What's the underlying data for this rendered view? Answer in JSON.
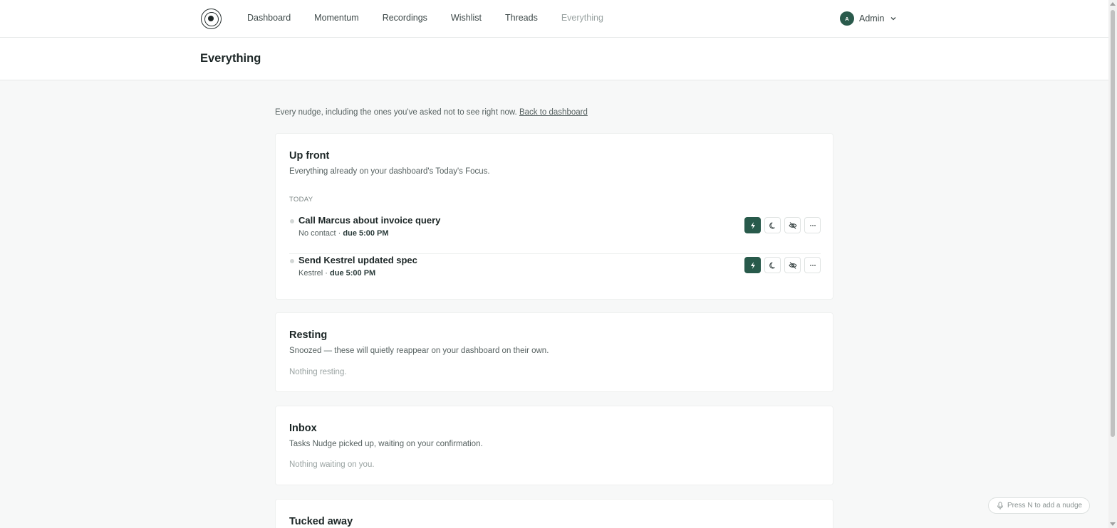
{
  "nav": {
    "logo": "logo-icon",
    "links": [
      "Dashboard",
      "Momentum",
      "Recordings",
      "Wishlist",
      "Threads",
      "Everything"
    ],
    "active": "Everything"
  },
  "user": {
    "initial": "A",
    "name": "Admin"
  },
  "page": {
    "title": "Everything"
  },
  "intro": {
    "text": "Every nudge, including the ones you've asked not to see right now.",
    "link": "Back to dashboard"
  },
  "sections": {
    "upfront": {
      "title": "Up front",
      "subtitle": "Everything already on your dashboard's Today's Focus.",
      "group_label": "TODAY",
      "items": [
        {
          "title": "Call Marcus about invoice query",
          "contact": "No contact",
          "due": "due 5:00 PM"
        },
        {
          "title": "Send Kestrel updated spec",
          "contact": "Kestrel",
          "due": "due 5:00 PM"
        }
      ]
    },
    "resting": {
      "title": "Resting",
      "subtitle": "Snoozed — these will quietly reappear on your dashboard on their own.",
      "empty": "Nothing resting."
    },
    "inbox": {
      "title": "Inbox",
      "subtitle": "Tasks Nudge picked up, waiting on your confirmation.",
      "empty": "Nothing waiting on you."
    },
    "tucked": {
      "title": "Tucked away"
    }
  },
  "actions": [
    "bolt-icon",
    "moon-icon",
    "eye-off-icon",
    "more-icon"
  ],
  "hint": "Press N to add a nudge",
  "colors": {
    "accent": "#285a4b",
    "background": "#f7f8f8"
  }
}
